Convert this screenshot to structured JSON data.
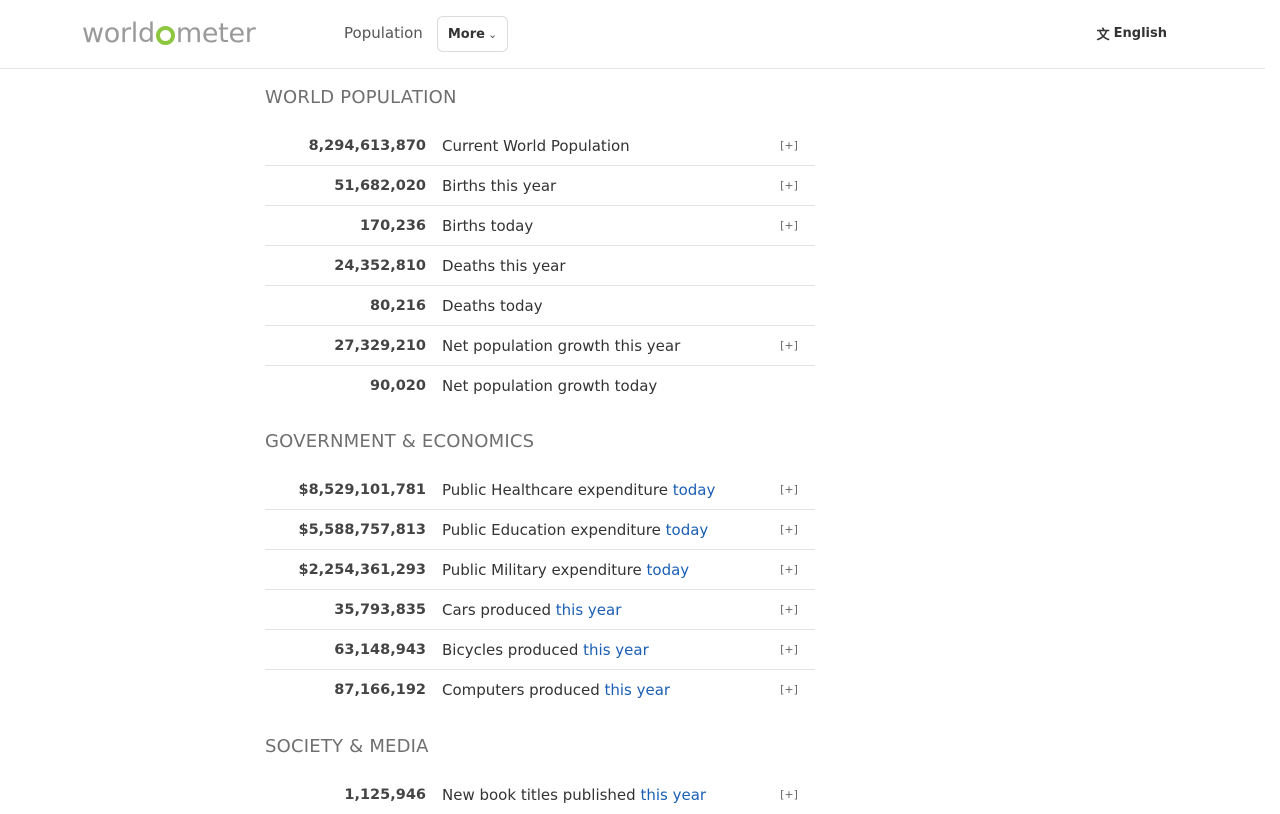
{
  "header": {
    "logo": {
      "before": "world",
      "after": "meter"
    },
    "nav_population": "Population",
    "more_label": "More",
    "language": "English"
  },
  "sections": [
    {
      "title": "WORLD POPULATION",
      "rows": [
        {
          "value": "8,294,613,870",
          "label": "Current World Population",
          "highlight": "",
          "expand": "[+]"
        },
        {
          "value": "51,682,020",
          "label": "Births this year",
          "highlight": "",
          "expand": "[+]"
        },
        {
          "value": "170,236",
          "label": "Births today",
          "highlight": "",
          "expand": "[+]"
        },
        {
          "value": "24,352,810",
          "label": "Deaths this year",
          "highlight": "",
          "expand": ""
        },
        {
          "value": "80,216",
          "label": "Deaths today",
          "highlight": "",
          "expand": ""
        },
        {
          "value": "27,329,210",
          "label": "Net population growth this year",
          "highlight": "",
          "expand": "[+]"
        },
        {
          "value": "90,020",
          "label": "Net population growth today",
          "highlight": "",
          "expand": ""
        }
      ]
    },
    {
      "title": "GOVERNMENT & ECONOMICS",
      "rows": [
        {
          "value": "$8,529,101,781",
          "label": "Public Healthcare expenditure",
          "highlight": "today",
          "expand": "[+]"
        },
        {
          "value": "$5,588,757,813",
          "label": "Public Education expenditure",
          "highlight": "today",
          "expand": "[+]"
        },
        {
          "value": "$2,254,361,293",
          "label": "Public Military expenditure",
          "highlight": "today",
          "expand": "[+]"
        },
        {
          "value": "35,793,835",
          "label": "Cars produced",
          "highlight": "this year",
          "expand": "[+]"
        },
        {
          "value": "63,148,943",
          "label": "Bicycles produced",
          "highlight": "this year",
          "expand": "[+]"
        },
        {
          "value": "87,166,192",
          "label": "Computers produced",
          "highlight": "this year",
          "expand": "[+]"
        }
      ]
    },
    {
      "title": "SOCIETY & MEDIA",
      "rows": [
        {
          "value": "1,125,946",
          "label": "New book titles published",
          "highlight": "this year",
          "expand": "[+]"
        }
      ]
    }
  ],
  "colors": {
    "logo_grey": "#9a9a9a",
    "logo_green": "#8dc63f",
    "highlight_blue": "#1a5fb4"
  }
}
